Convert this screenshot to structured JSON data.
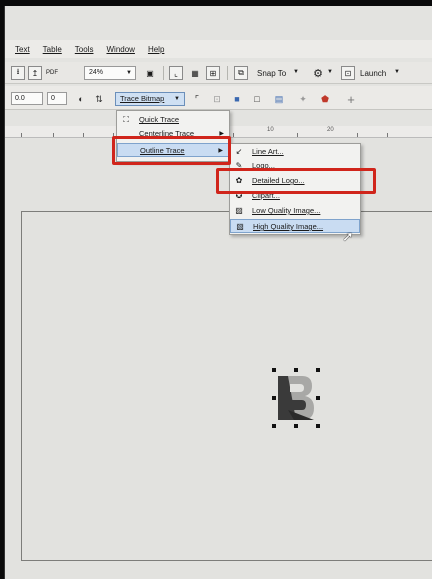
{
  "menubar": {
    "items": [
      "Text",
      "Table",
      "Tools",
      "Window",
      "Help"
    ]
  },
  "toolbar1": {
    "zoom": "24%",
    "snap_to": "Snap To",
    "launch": "Launch"
  },
  "toolbar2": {
    "coord": "0.0",
    "value": "0",
    "trace_bitmap": "Trace Bitmap",
    "plus": "+"
  },
  "ruler": {
    "labels": [
      "10",
      "20"
    ]
  },
  "trace_menu": {
    "items": [
      {
        "label": "Quick Trace",
        "icon": "quick-trace-icon"
      },
      {
        "label": "Centerline Trace",
        "icon": ""
      },
      {
        "label": "Outline Trace",
        "icon": "",
        "highlighted": true
      }
    ]
  },
  "outline_submenu": {
    "items": [
      {
        "label": "Line Art...",
        "icon": "line-art-icon"
      },
      {
        "label": "Logo...",
        "icon": "logo-icon"
      },
      {
        "label": "Detailed Logo...",
        "icon": "detailed-logo-icon"
      },
      {
        "label": "Clipart...",
        "icon": "clipart-icon"
      },
      {
        "label": "Low Quality Image...",
        "icon": "low-quality-image-icon"
      },
      {
        "label": "High Quality Image...",
        "icon": "high-quality-image-icon",
        "highlighted": true
      }
    ]
  },
  "colors": {
    "highlight_box": "#d0251b",
    "menu_hover": "#c9dcf2",
    "trace_button": "#cfe0f3"
  }
}
